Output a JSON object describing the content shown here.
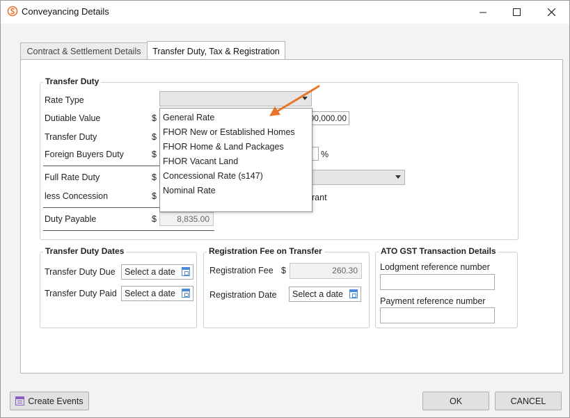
{
  "window": {
    "title": "Conveyancing Details",
    "accent": "#e8742a"
  },
  "tabs": [
    {
      "label": "Contract & Settlement Details",
      "active": false
    },
    {
      "label": "Transfer Duty, Tax & Registration",
      "active": true
    }
  ],
  "transfer_duty": {
    "title": "Transfer Duty",
    "rate_type_label": "Rate Type",
    "dutiable_value_label": "Dutiable Value",
    "dutiable_value_partial": "00,000.00",
    "transfer_duty_label": "Transfer Duty",
    "foreign_buyers_duty_label": "Foreign Buyers Duty",
    "percent_symbol": "%",
    "full_rate_duty_label": "Full Rate Duty",
    "less_concession_label": "less Concession",
    "grant_partial": "rant",
    "duty_payable_label": "Duty Payable",
    "duty_payable_value": "8,835.00",
    "currency": "$"
  },
  "rate_type_dropdown": {
    "options": [
      "General Rate",
      "FHOR New or Established Homes",
      "FHOR Home & Land Packages",
      "FHOR Vacant Land",
      "Concessional Rate (s147)",
      "Nominal Rate"
    ]
  },
  "transfer_duty_dates": {
    "title": "Transfer Duty Dates",
    "due_label": "Transfer Duty Due",
    "paid_label": "Transfer Duty Paid",
    "date_placeholder": "Select a date"
  },
  "registration": {
    "title": "Registration Fee on Transfer",
    "fee_label": "Registration Fee",
    "fee_value": "260.30",
    "date_label": "Registration Date",
    "date_placeholder": "Select a date",
    "currency": "$"
  },
  "ato_gst": {
    "title": "ATO GST Transaction Details",
    "lodgment_label": "Lodgment reference number",
    "payment_label": "Payment reference number"
  },
  "footer": {
    "create_events_label": "Create Events",
    "ok_label": "OK",
    "cancel_label": "CANCEL"
  },
  "icons": [
    "app-logo-icon",
    "minimize-icon",
    "maximize-icon",
    "close-icon",
    "chevron-down-icon",
    "calendar-icon",
    "annotation-arrow"
  ]
}
